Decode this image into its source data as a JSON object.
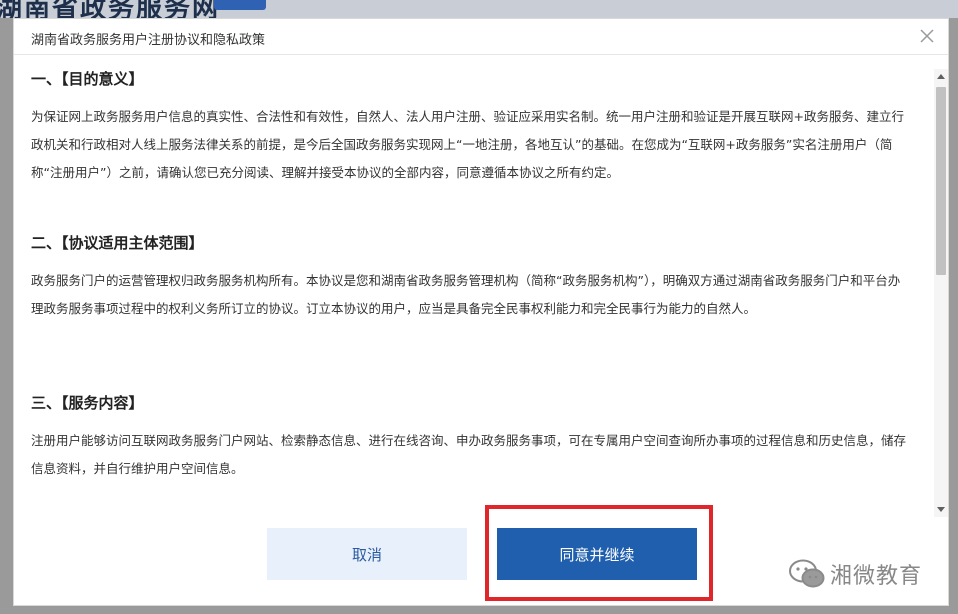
{
  "background": {
    "title": "湖南省政务服务网"
  },
  "dialog": {
    "title": "湖南省政务服务用户注册协议和隐私政策",
    "sections": [
      {
        "heading": "一、【目的意义】",
        "body": "为保证网上政务服务用户信息的真实性、合法性和有效性，自然人、法人用户注册、验证应采用实名制。统一用户注册和验证是开展互联网+政务服务、建立行政机关和行政相对人线上服务法律关系的前提，是今后全国政务服务实现网上“一地注册，各地互认”的基础。在您成为“互联网+政务服务”实名注册用户（简称“注册用户”）之前，请确认您已充分阅读、理解并接受本协议的全部内容，同意遵循本协议之所有约定。"
      },
      {
        "heading": "二、【协议适用主体范围】",
        "body": "政务服务门户的运营管理权归政务服务机构所有。本协议是您和湖南省政务服务管理机构（简称“政务服务机构”），明确双方通过湖南省政务服务门户和平台办理政务服务事项过程中的权利义务所订立的协议。订立本协议的用户，应当是具备完全民事权利能力和完全民事行为能力的自然人。"
      },
      {
        "heading": "三、【服务内容】",
        "body": "注册用户能够访问互联网政务服务门户网站、检索静态信息、进行在线咨询、申办政务服务事项，可在专属用户空间查询所办事项的过程信息和历史信息，储存信息资料，并自行维护用户空间信息。"
      }
    ],
    "buttons": {
      "cancel": "取消",
      "agree": "同意并继续"
    }
  },
  "watermark": {
    "text": "湘微教育",
    "icon": "wechat-icon"
  },
  "colors": {
    "primary": "#1f5fad",
    "cancel_bg": "#e8f1fb",
    "highlight": "#e0252b"
  }
}
